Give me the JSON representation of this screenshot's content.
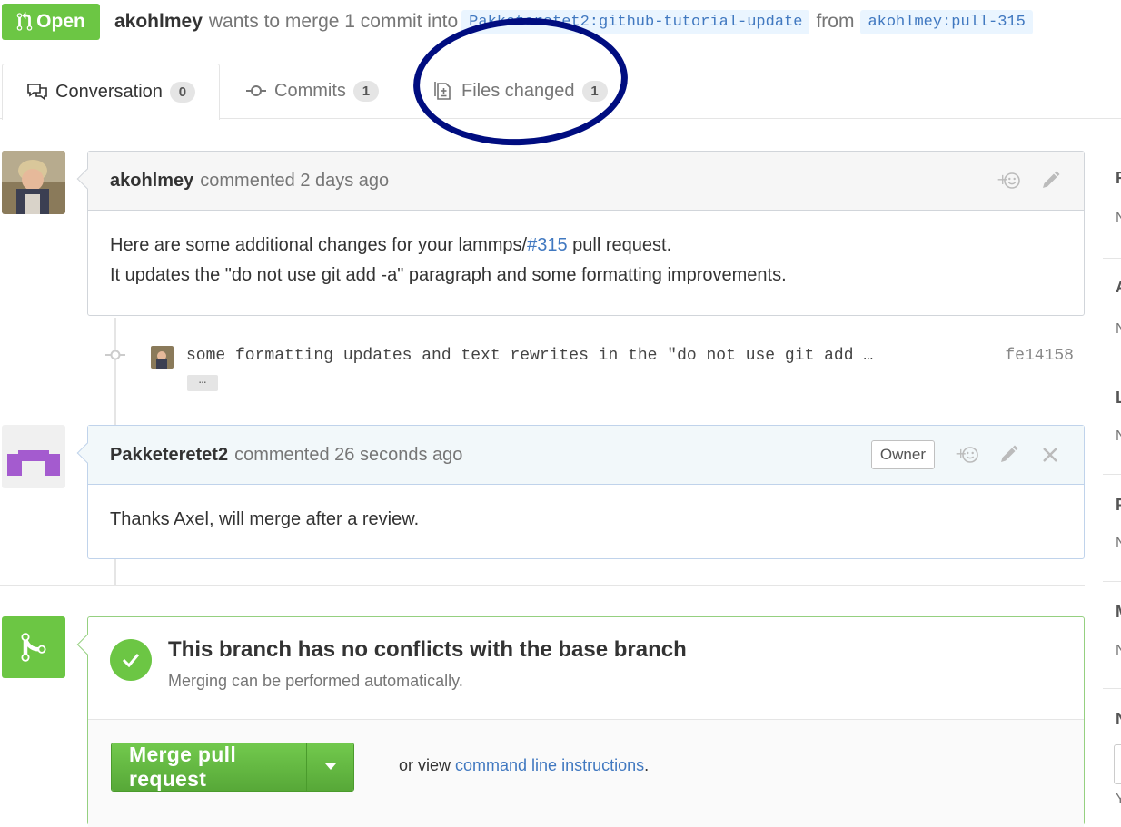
{
  "header": {
    "state": "Open",
    "author": "akohlmey",
    "summary_text": "wants to merge 1 commit into",
    "base_branch": "Pakketeretet2:github-tutorial-update",
    "from_text": "from",
    "head_branch": "akohlmey:pull-315"
  },
  "tabs": [
    {
      "label": "Conversation",
      "count": "0"
    },
    {
      "label": "Commits",
      "count": "1"
    },
    {
      "label": "Files changed",
      "count": "1"
    }
  ],
  "comments": [
    {
      "author": "akohlmey",
      "meta": "commented 2 days ago",
      "body_line1_prefix": "Here are some additional changes for your lammps/",
      "body_line1_link": "#315",
      "body_line1_suffix": " pull request.",
      "body_line2": "It updates the \"do not use git add -a\" paragraph and some formatting improvements."
    },
    {
      "author": "Pakketeretet2",
      "meta": "commented 26 seconds ago",
      "owner_label": "Owner",
      "body": "Thanks Axel, will merge after a review."
    }
  ],
  "commit": {
    "message": "some formatting updates and text rewrites in the \"do not use git add …",
    "expander": "…",
    "sha": "fe14158"
  },
  "merge": {
    "heading": "This branch has no conflicts with the base branch",
    "subtext": "Merging can be performed automatically.",
    "button_label": "Merge pull request",
    "alt_prefix": "or view ",
    "alt_link": "command line instructions",
    "alt_suffix": "."
  },
  "sidebar": {
    "labels": [
      "R",
      "A",
      "L",
      "P",
      "M",
      "N"
    ],
    "values": [
      "N",
      "N",
      "N",
      "N",
      "N",
      "Y"
    ]
  },
  "colors": {
    "green": "#6cc644",
    "link_blue": "#4078c0",
    "annotation_oval": "#000d80"
  },
  "icons": {
    "state": "git-pull-request-icon",
    "conversation": "comment-discussion-icon",
    "commits": "git-commit-icon",
    "files": "diff-icon",
    "reaction": "smiley-add-icon",
    "edit": "pencil-icon",
    "delete": "close-icon",
    "merge": "git-merge-icon",
    "check": "check-icon",
    "dropdown": "triangle-down-icon"
  }
}
